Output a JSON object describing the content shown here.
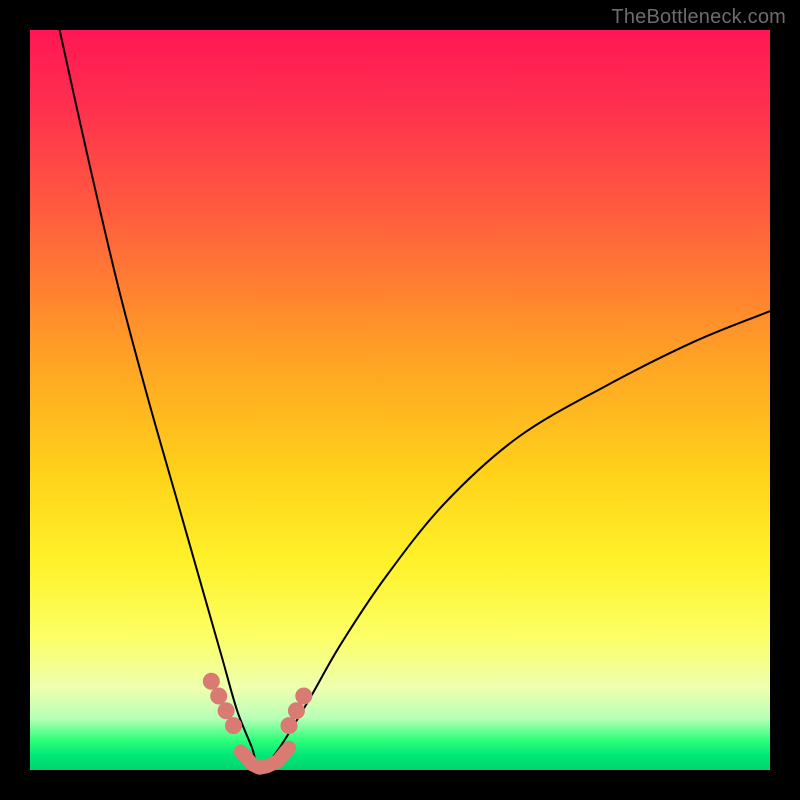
{
  "watermark": "TheBottleneck.com",
  "colors": {
    "background": "#000000",
    "gradient_top": "#ff1754",
    "gradient_mid": "#ffd21a",
    "gradient_bottom_yellow": "#fcff66",
    "gradient_green": "#00e877",
    "curve": "#000000",
    "beads": "#d97b72"
  },
  "chart_data": {
    "type": "line",
    "title": "",
    "xlabel": "",
    "ylabel": "",
    "xlim": [
      0,
      100
    ],
    "ylim": [
      0,
      100
    ],
    "annotations": [
      "TheBottleneck.com"
    ],
    "legend": [],
    "grid": false,
    "notes": "V-shaped bottleneck curve; minimum near x≈31 at y≈0. Left branch rises to y≈100 at x≈4; right branch rises to y≈62 at x=100. Salmon beads/segment trace the curve through the green optimal band near the bottom.",
    "series": [
      {
        "name": "bottleneck-curve",
        "x": [
          4,
          8,
          12,
          16,
          20,
          24,
          26,
          28,
          30,
          31,
          33,
          35,
          38,
          42,
          48,
          56,
          66,
          78,
          90,
          100
        ],
        "y": [
          100,
          82,
          65,
          50,
          36,
          22,
          15,
          8,
          3,
          0,
          2,
          5,
          10,
          17,
          26,
          36,
          45,
          52,
          58,
          62
        ]
      }
    ],
    "bead_points_x": [
      24.5,
      25.5,
      26.5,
      27.5,
      35.0,
      36.0,
      37.0
    ],
    "bead_points_y": [
      12.0,
      10.0,
      8.0,
      6.0,
      6.0,
      8.0,
      10.0
    ],
    "bead_segment": {
      "x": [
        28.5,
        30.0,
        31.0,
        32.0,
        33.5,
        35.0
      ],
      "y": [
        2.5,
        0.8,
        0.3,
        0.5,
        1.2,
        3.0
      ]
    }
  }
}
